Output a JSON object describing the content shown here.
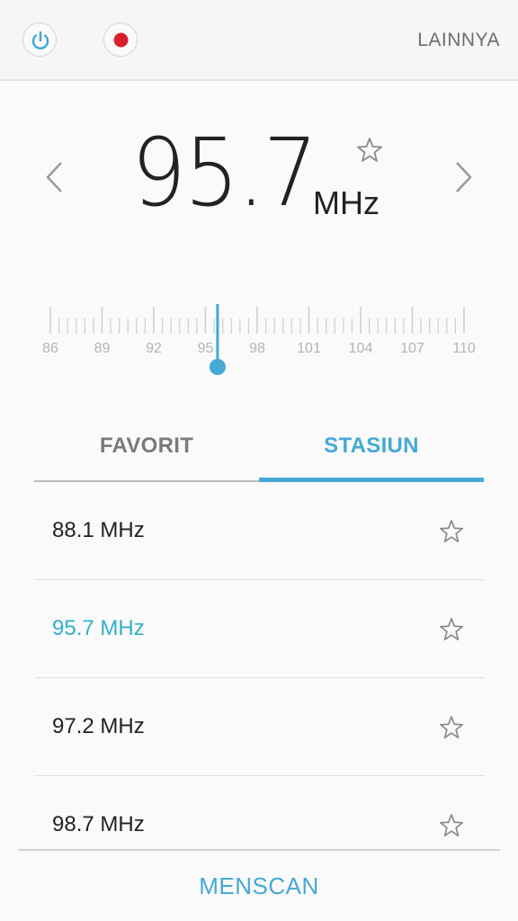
{
  "toolbar": {
    "power_icon": "power-icon",
    "record_icon": "record-icon",
    "more_label": "LAINNYA"
  },
  "tuner": {
    "frequency": "95.7",
    "unit": "MHz",
    "favorite_icon": "star-outline-icon",
    "prev_icon": "chevron-left-icon",
    "next_icon": "chevron-right-icon"
  },
  "dial": {
    "min": 86,
    "max": 110,
    "current": 95.7,
    "labels": [
      "86",
      "89",
      "92",
      "95",
      "98",
      "101",
      "104",
      "107",
      "110"
    ]
  },
  "tabs": [
    {
      "label": "FAVORIT",
      "active": false
    },
    {
      "label": "STASIUN",
      "active": true
    }
  ],
  "stations": [
    {
      "label": "88.1 MHz",
      "active": false
    },
    {
      "label": "95.7 MHz",
      "active": true
    },
    {
      "label": "97.2 MHz",
      "active": false
    },
    {
      "label": "98.7 MHz",
      "active": false
    }
  ],
  "bottom": {
    "scan_label": "MENSCAN"
  },
  "colors": {
    "accent": "#45a9d6",
    "active_station": "#2fb0ca",
    "record": "#d6202a"
  }
}
